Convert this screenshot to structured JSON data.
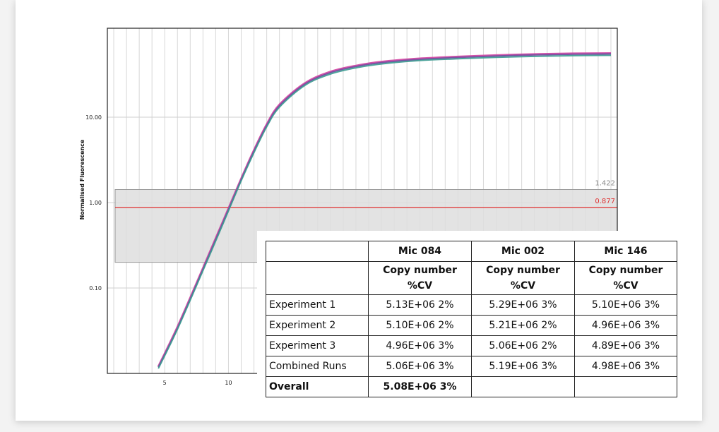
{
  "chart_data": {
    "type": "line",
    "xlabel": "",
    "ylabel": "Normalised Fluorescence",
    "yscale": "log",
    "xlim": [
      0.5,
      40.5
    ],
    "ylim": [
      0.01,
      110
    ],
    "xticks": [
      {
        "value": 5,
        "label": "5"
      },
      {
        "value": 10,
        "label": "10"
      }
    ],
    "yticks": [
      {
        "value": 0.1,
        "label": "0.10"
      },
      {
        "value": 1,
        "label": "1.00"
      },
      {
        "value": 10,
        "label": "10.00"
      }
    ],
    "grid": true,
    "threshold_band": {
      "upper": 1.422,
      "upper_label": "1.422",
      "lower": 0.2
    },
    "threshold_line": {
      "value": 0.877,
      "label": "0.877",
      "color": "#e03030"
    },
    "series": [
      {
        "color": "#d040a0",
        "x": [
          4.5,
          6,
          8,
          9,
          10,
          11,
          12,
          13,
          14,
          16,
          18,
          20,
          22,
          25,
          28,
          31,
          34,
          37,
          40
        ],
        "y": [
          0.012,
          0.035,
          0.17,
          0.38,
          0.85,
          1.9,
          4.1,
          8.2,
          14,
          25,
          34,
          40,
          44.5,
          48.5,
          51,
          53,
          54.5,
          55.5,
          56
        ]
      },
      {
        "color": "#7050a0",
        "x": [
          4.5,
          6,
          8,
          9,
          10,
          11,
          12,
          13,
          14,
          16,
          18,
          20,
          22,
          25,
          28,
          31,
          34,
          37,
          40
        ],
        "y": [
          0.0118,
          0.034,
          0.166,
          0.37,
          0.83,
          1.86,
          4.0,
          8.0,
          13.6,
          24.4,
          33.2,
          39.2,
          43.5,
          47.5,
          50,
          52,
          53.5,
          54.5,
          55
        ]
      },
      {
        "color": "#3a9a90",
        "x": [
          4.5,
          6,
          8,
          9,
          10,
          11,
          12,
          13,
          14,
          16,
          18,
          20,
          22,
          25,
          28,
          31,
          34,
          37,
          40
        ],
        "y": [
          0.0114,
          0.033,
          0.16,
          0.355,
          0.8,
          1.8,
          3.85,
          7.7,
          13.1,
          23.6,
          32,
          37.8,
          42,
          46,
          48.3,
          50.2,
          51.5,
          52.5,
          53
        ]
      }
    ]
  },
  "table": {
    "headers": [
      "",
      "Mic 084",
      "Mic 002",
      "Mic 146"
    ],
    "subheaders": [
      "",
      "Copy number %CV",
      "Copy number %CV",
      "Copy number %CV"
    ],
    "rows": [
      {
        "label": "Experiment 1",
        "cells": [
          "5.13E+06 2%",
          "5.29E+06 3%",
          "5.10E+06 3%"
        ]
      },
      {
        "label": "Experiment 2",
        "cells": [
          "5.10E+06 2%",
          "5.21E+06 2%",
          "4.96E+06 3%"
        ]
      },
      {
        "label": "Experiment 3",
        "cells": [
          "4.96E+06 3%",
          "5.06E+06 2%",
          "4.89E+06 3%"
        ]
      },
      {
        "label": "Combined Runs",
        "cells": [
          "5.06E+06 3%",
          "5.19E+06 3%",
          "4.98E+06 3%"
        ]
      },
      {
        "label": "Overall",
        "cells": [
          "5.08E+06 3%",
          "",
          ""
        ],
        "bold": true
      }
    ]
  }
}
